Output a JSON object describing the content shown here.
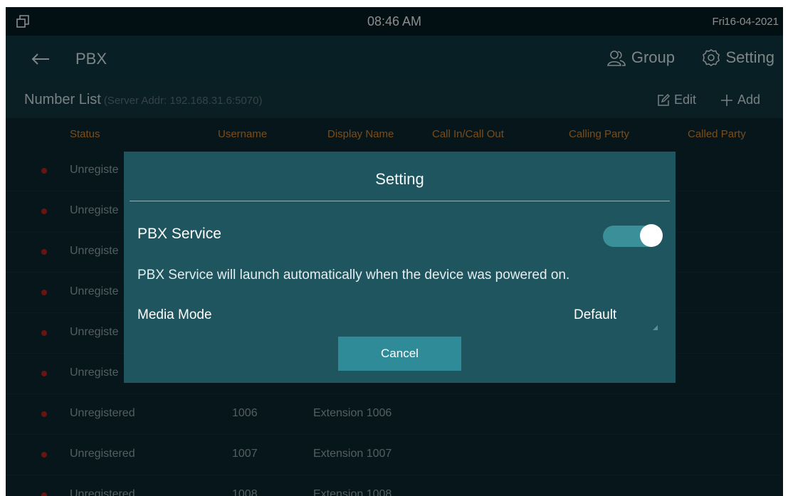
{
  "statusbar": {
    "time": "08:46 AM",
    "day": "Fri",
    "date": "16-04-2021"
  },
  "header": {
    "title": "PBX",
    "group_label": "Group",
    "setting_label": "Setting"
  },
  "number_list": {
    "title": "Number List",
    "server_addr": "(Server Addr: 192.168.31.6:5070)",
    "edit_label": "Edit",
    "add_label": "Add"
  },
  "table": {
    "columns": [
      "Status",
      "Username",
      "Display Name",
      "Call In/Call Out",
      "Calling Party",
      "Called Party"
    ],
    "rows": [
      {
        "status": "Unregiste",
        "username": "",
        "display_name": ""
      },
      {
        "status": "Unregiste",
        "username": "",
        "display_name": ""
      },
      {
        "status": "Unregiste",
        "username": "",
        "display_name": ""
      },
      {
        "status": "Unregiste",
        "username": "",
        "display_name": ""
      },
      {
        "status": "Unregiste",
        "username": "",
        "display_name": ""
      },
      {
        "status": "Unregiste",
        "username": "",
        "display_name": ""
      },
      {
        "status": "Unregistered",
        "username": "1006",
        "display_name": "Extension 1006"
      },
      {
        "status": "Unregistered",
        "username": "1007",
        "display_name": "Extension 1007"
      },
      {
        "status": "Unregistered",
        "username": "1008",
        "display_name": "Extension 1008"
      }
    ]
  },
  "dialog": {
    "title": "Setting",
    "pbx_service_label": "PBX Service",
    "pbx_service_enabled": true,
    "description": "PBX Service will launch automatically when the device was powered on.",
    "media_mode_label": "Media Mode",
    "media_mode_value": "Default",
    "cancel_label": "Cancel"
  },
  "colors": {
    "background": "#0c2930",
    "header": "#0e3a44",
    "dialog": "#1f555f",
    "accent": "#2e8b97",
    "column_header": "#e08a2c",
    "status_dot": "#c0261f"
  }
}
